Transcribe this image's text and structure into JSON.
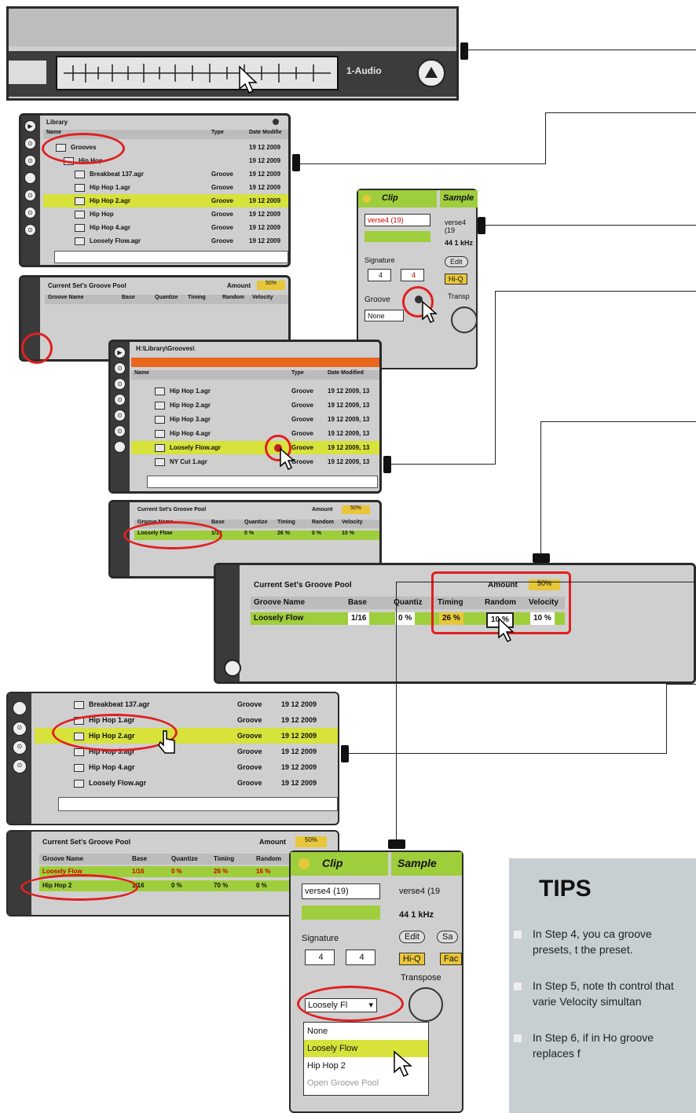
{
  "top_bar": {
    "track_label": "1-Audio"
  },
  "library": {
    "path": "Library",
    "cols": {
      "name": "Name",
      "type": "Type",
      "date": "Date Modifie"
    },
    "items": [
      {
        "name": "Grooves",
        "type": "",
        "date": "19 12 2009"
      },
      {
        "name": "Hip Hop",
        "type": "",
        "date": "19 12 2009"
      },
      {
        "name": "Breakbeat 137.agr",
        "type": "Groove",
        "date": "19 12 2009"
      },
      {
        "name": "Hip Hop 1.agr",
        "type": "Groove",
        "date": "19 12 2009"
      },
      {
        "name": "Hip Hop 2.agr",
        "type": "Groove",
        "date": "19 12 2009"
      },
      {
        "name": "Hip Hop",
        "type": "Groove",
        "date": "19 12 2009"
      },
      {
        "name": "Hip Hop 4.agr",
        "type": "Groove",
        "date": "19 12 2009"
      },
      {
        "name": "Loosely Flow.agr",
        "type": "Groove",
        "date": "19 12 2009"
      }
    ]
  },
  "pool": {
    "title": "Current Set's Groove Pool",
    "amount_label": "Amount",
    "amount_value": "50%",
    "cols": [
      "Groove Name",
      "Base",
      "Quantize",
      "Timing",
      "Random",
      "Velocity"
    ]
  },
  "clip": {
    "title": "Clip",
    "sample_title": "Sample",
    "clip_name": "verse4 (19)",
    "signature_label": "Signature",
    "sig_num": "4",
    "sig_den": "4",
    "groove_label": "Groove",
    "groove_value": "None",
    "sample_name": "verse4 (19",
    "sample_rate": "44 1 kHz",
    "edit_label": "Edit",
    "hiq_label": "Hi-Q",
    "transpose_label": "Transp"
  },
  "library2": {
    "path": "H:\\Library\\Grooves\\",
    "cols": {
      "name": "Name",
      "type": "Type",
      "date": "Date Modified"
    },
    "items": [
      {
        "name": "Hip Hop 1.agr",
        "type": "Groove",
        "date": "19 12 2009, 13"
      },
      {
        "name": "Hip Hop 2.agr",
        "type": "Groove",
        "date": "19 12 2009, 13"
      },
      {
        "name": "Hip Hop 3.agr",
        "type": "Groove",
        "date": "19 12 2009, 13"
      },
      {
        "name": "Hip Hop 4.agr",
        "type": "Groove",
        "date": "19 12 2009, 13"
      },
      {
        "name": "Loosely Flow.agr",
        "type": "Groove",
        "date": "19 12 2009, 13"
      },
      {
        "name": "NY Cut 1.agr",
        "type": "Groove",
        "date": "19 12 2009, 13"
      }
    ],
    "pool_row": {
      "name": "Loosely Flow",
      "base": "1/16",
      "quantize": "0 %",
      "timing": "26 %",
      "random": "0 %",
      "velocity": "10 %"
    }
  },
  "pool_large": {
    "title": "Current Set's Groove Pool",
    "amount_label": "Amount",
    "amount_value": "50%",
    "cols": [
      "Groove Name",
      "Base",
      "Quantiz",
      "Timing",
      "Random",
      "Velocity"
    ],
    "row": {
      "name": "Loosely Flow",
      "base": "1/16",
      "quantize": "0 %",
      "timing": "26 %",
      "random": "10 %",
      "velocity": "10 %"
    }
  },
  "library3": {
    "items": [
      {
        "name": "Breakbeat 137.agr",
        "type": "Groove",
        "date": "19 12 2009"
      },
      {
        "name": "Hip Hop 1.agr",
        "type": "Groove",
        "date": "19 12 2009"
      },
      {
        "name": "Hip Hop 2.agr",
        "type": "Groove",
        "date": "19 12 2009"
      },
      {
        "name": "Hip Hop 3.agr",
        "type": "Groove",
        "date": "19 12 2009"
      },
      {
        "name": "Hip Hop 4.agr",
        "type": "Groove",
        "date": "19 12 2009"
      },
      {
        "name": "Loosely Flow.agr",
        "type": "Groove",
        "date": "19 12 2009"
      }
    ]
  },
  "pool3": {
    "title": "Current Set's Groove Pool",
    "amount_label": "Amount",
    "amount_value": "50%",
    "cols": [
      "Groove Name",
      "Base",
      "Quantize",
      "Timing",
      "Random"
    ],
    "rows": [
      {
        "name": "Loosely Flow",
        "base": "1/16",
        "quantize": "0 %",
        "timing": "26 %",
        "random": "16 %"
      },
      {
        "name": "Hip Hop 2",
        "base": "1/16",
        "quantize": "0 %",
        "timing": "70 %",
        "random": "0 %"
      }
    ]
  },
  "clip2": {
    "title": "Clip",
    "sample_title": "Sample",
    "clip_name": "verse4 (19)",
    "sample_name": "verse4 (19",
    "sample_rate": "44 1 kHz",
    "signature_label": "Signature",
    "sig_num": "4",
    "sig_den": "4",
    "edit_label": "Edit",
    "save_label": "Sa",
    "hiq_label": "Hi-Q",
    "fade_label": "Fac",
    "transpose_label": "Transpose",
    "groove_value": "Loosely Fl",
    "menu": [
      "None",
      "Loosely Flow",
      "Hip Hop 2",
      "Open Groove Pool"
    ]
  },
  "tips": {
    "title": "TIPS",
    "items": [
      "In Step 4, you ca groove presets, t the preset.",
      "In Step 5, note th control that varie Velocity simultan",
      "In Step 6, if in Ho groove replaces f"
    ]
  }
}
